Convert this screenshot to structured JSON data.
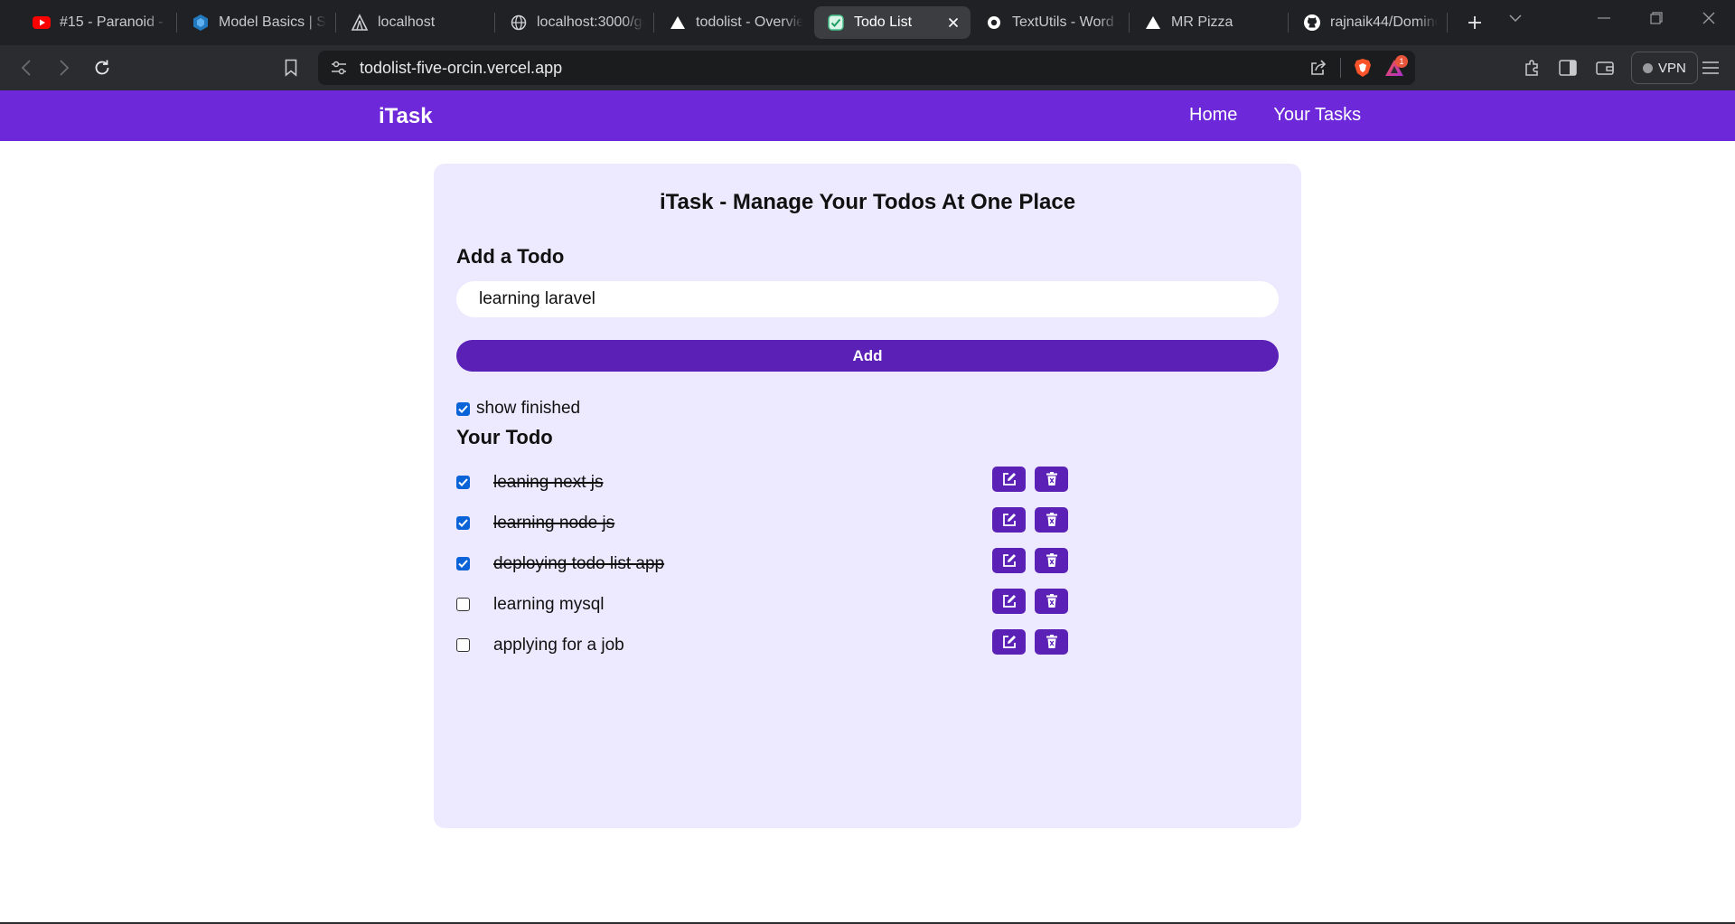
{
  "browser": {
    "tabs": [
      {
        "title": "#15 - Paranoid - S",
        "icon": "youtube-icon",
        "active": false
      },
      {
        "title": "Model Basics | Seq",
        "icon": "sequelize-icon",
        "active": false
      },
      {
        "title": "localhost",
        "icon": "localhost-icon",
        "active": false
      },
      {
        "title": "localhost:3000/ge",
        "icon": "globe-icon",
        "active": false
      },
      {
        "title": "todolist - Overview",
        "icon": "vercel-icon",
        "active": false
      },
      {
        "title": "Todo List",
        "icon": "todo-icon",
        "active": true
      },
      {
        "title": "TextUtils - Word c",
        "icon": "circle-icon",
        "active": false
      },
      {
        "title": "MR Pizza",
        "icon": "vercel-icon",
        "active": false
      },
      {
        "title": "rajnaik44/Domino",
        "icon": "github-icon",
        "active": false
      }
    ],
    "url": "todolist-five-orcin.vercel.app",
    "notification_count": "1",
    "vpn_label": "VPN"
  },
  "nav": {
    "brand": "iTask",
    "links": [
      "Home",
      "Your Tasks"
    ]
  },
  "main": {
    "title": "iTask - Manage Your Todos At One Place",
    "add_heading": "Add a Todo",
    "input_value": "learning laravel",
    "add_button": "Add",
    "show_finished_label": "show finished",
    "show_finished_checked": true,
    "list_heading": "Your Todo",
    "todos": [
      {
        "text": "leaning next js",
        "done": true
      },
      {
        "text": "learning node js",
        "done": true
      },
      {
        "text": "deploying todo list app",
        "done": true
      },
      {
        "text": "learning mysql",
        "done": false
      },
      {
        "text": "applying for a job",
        "done": false
      }
    ]
  },
  "colors": {
    "navbar": "#6d28d9",
    "button": "#5b21b6",
    "card": "#ede9fe",
    "checkbox": "#0b63d8"
  }
}
